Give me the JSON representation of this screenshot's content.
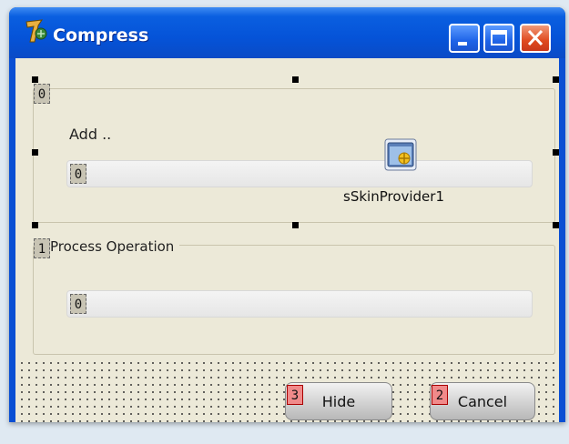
{
  "window": {
    "title": "Compress"
  },
  "form": {
    "group1_taborder": "0",
    "add_label": "Add ..",
    "edit1_taborder": "0",
    "skin_component_label": "sSkinProvider1",
    "group2_taborder": "1",
    "group2_caption": "Process Operation",
    "edit2_taborder": "0",
    "hide_button": {
      "label": "Hide",
      "taborder": "3"
    },
    "cancel_button": {
      "label": "Cancel",
      "taborder": "2"
    }
  },
  "colors": {
    "titlebar": "#0553d8",
    "client_bg": "#ece9d8",
    "close_button": "#e04a1f",
    "taborder_red": "#f08a8a"
  },
  "icons": [
    "delphi-app-icon",
    "minimize-icon",
    "maximize-icon",
    "close-icon",
    "skin-provider-icon"
  ]
}
